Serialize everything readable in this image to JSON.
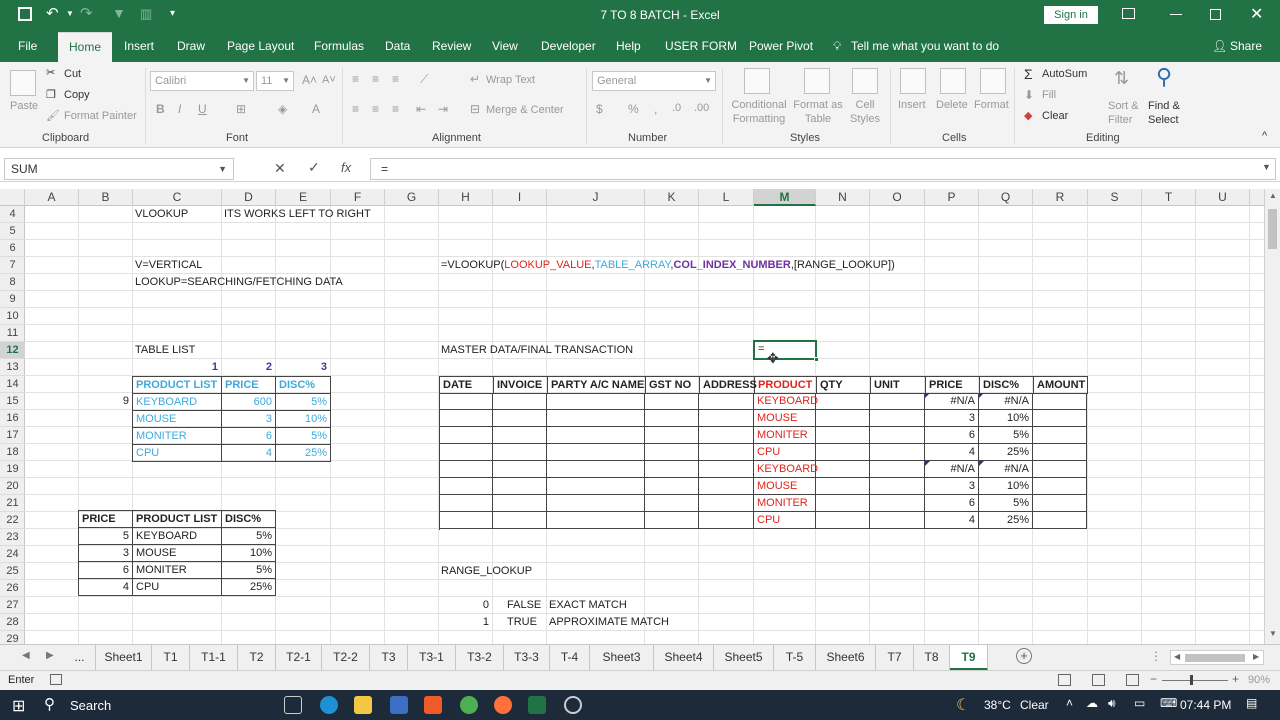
{
  "window": {
    "title": "7 TO 8 BATCH - Excel",
    "signin": "Sign in"
  },
  "menu": {
    "tabs": [
      "File",
      "Home",
      "Insert",
      "Draw",
      "Page Layout",
      "Formulas",
      "Data",
      "Review",
      "View",
      "Developer",
      "Help",
      "USER FORM",
      "Power Pivot"
    ],
    "active": "Home",
    "tell_me": "Tell me what you want to do",
    "share": "Share"
  },
  "ribbon": {
    "clipboard": {
      "paste": "Paste",
      "cut": "Cut",
      "copy": "Copy",
      "format_painter": "Format Painter",
      "group": "Clipboard"
    },
    "font": {
      "name": "Calibri",
      "size": "11",
      "group": "Font"
    },
    "alignment": {
      "wrap": "Wrap Text",
      "merge": "Merge & Center",
      "group": "Alignment"
    },
    "number": {
      "format": "General",
      "group": "Number"
    },
    "styles": {
      "conditional": "Conditional Formatting",
      "format_as_table": "Format as Table",
      "cell_styles": "Cell Styles",
      "group": "Styles"
    },
    "cells": {
      "insert": "Insert",
      "delete": "Delete",
      "format": "Format",
      "group": "Cells"
    },
    "editing": {
      "autosum": "AutoSum",
      "fill": "Fill",
      "clear": "Clear",
      "sort": "Sort & Filter",
      "find": "Find & Select",
      "group": "Editing"
    }
  },
  "formula_bar": {
    "name_box": "SUM",
    "fx": "fx",
    "content": "="
  },
  "columns": [
    "A",
    "B",
    "C",
    "D",
    "E",
    "F",
    "G",
    "H",
    "I",
    "J",
    "K",
    "L",
    "M",
    "N",
    "O",
    "P",
    "Q",
    "R",
    "S",
    "T",
    "U"
  ],
  "selected_column": "M",
  "rows": [
    "4",
    "5",
    "6",
    "7",
    "8",
    "9",
    "10",
    "11",
    "12",
    "13",
    "14",
    "15",
    "16",
    "17",
    "18",
    "19",
    "20",
    "21",
    "22",
    "23",
    "24",
    "25",
    "26",
    "27",
    "28",
    "29"
  ],
  "selected_row": "12",
  "sheet": {
    "c4": "VLOOKUP",
    "d4": "ITS WORKS LEFT TO RIGHT",
    "c7": "V=VERTICAL",
    "c8": "LOOKUP=SEARCHING/FETCHING DATA",
    "h7_prefix": "=VLOOKUP(",
    "h7_a1": "LOOKUP_VALUE",
    "h7_sep1": ",",
    "h7_a2": "TABLE_ARRAY",
    "h7_sep2": ",",
    "h7_a3": "COL_INDEX_NUMBER",
    "h7_rest": ",[RANGE_LOOKUP])",
    "c12": "TABLE LIST",
    "h12": "MASTER DATA/FINAL TRANSACTION",
    "m12": "=",
    "d13": "1",
    "e13": "2",
    "f13": "3",
    "b15": "9",
    "table_list": {
      "headers": [
        "PRODUCT LIST",
        "PRICE",
        "DISC%"
      ],
      "rows": [
        [
          "KEYBOARD",
          "600",
          "5%"
        ],
        [
          "MOUSE",
          "3",
          "10%"
        ],
        [
          "MONITER",
          "6",
          "5%"
        ],
        [
          "CPU",
          "4",
          "25%"
        ]
      ]
    },
    "price_list": {
      "headers": [
        "PRICE",
        "PRODUCT LIST",
        "DISC%"
      ],
      "rows": [
        [
          "5",
          "KEYBOARD",
          "5%"
        ],
        [
          "3",
          "MOUSE",
          "10%"
        ],
        [
          "6",
          "MONITER",
          "5%"
        ],
        [
          "4",
          "CPU",
          "25%"
        ]
      ]
    },
    "master": {
      "headers": [
        "DATE",
        "INVOICE",
        "PARTY A/C NAME",
        "GST NO",
        "ADDRESS",
        "PRODUCT",
        "QTY",
        "UNIT",
        "PRICE",
        "DISC%",
        "AMOUNT"
      ],
      "rows": [
        [
          "KEYBOARD",
          "#N/A",
          "#N/A"
        ],
        [
          "MOUSE",
          "3",
          "10%"
        ],
        [
          "MONITER",
          "6",
          "5%"
        ],
        [
          "CPU",
          "4",
          "25%"
        ],
        [
          "KEYBOARD",
          "#N/A",
          "#N/A"
        ],
        [
          "MOUSE",
          "3",
          "10%"
        ],
        [
          "MONITER",
          "6",
          "5%"
        ],
        [
          "CPU",
          "4",
          "25%"
        ]
      ]
    },
    "h25": "RANGE_LOOKUP",
    "range_rows": [
      [
        "0",
        "FALSE",
        "EXACT MATCH"
      ],
      [
        "1",
        "TRUE",
        "APPROXIMATE MATCH"
      ]
    ]
  },
  "sheet_tabs": [
    "...",
    "Sheet1",
    "T1",
    "T1-1",
    "T2",
    "T2-1",
    "T2-2",
    "T3",
    "T3-1",
    "T3-2",
    "T3-3",
    "T-4",
    "Sheet3",
    "Sheet4",
    "Sheet5",
    "T-5",
    "Sheet6",
    "T7",
    "T8",
    "T9"
  ],
  "active_sheet": "T9",
  "status": {
    "mode": "Enter",
    "zoom": "90%"
  },
  "taskbar": {
    "search": "Search",
    "weather": "38°C",
    "weather_desc": "Clear",
    "time": "07:44 PM"
  },
  "colors": {
    "excel_green": "#217346",
    "blue_text": "#3fa9dc",
    "red_text": "#e0241b",
    "navy_text": "#3a3aa0",
    "purple_arg": "#7030a0"
  }
}
